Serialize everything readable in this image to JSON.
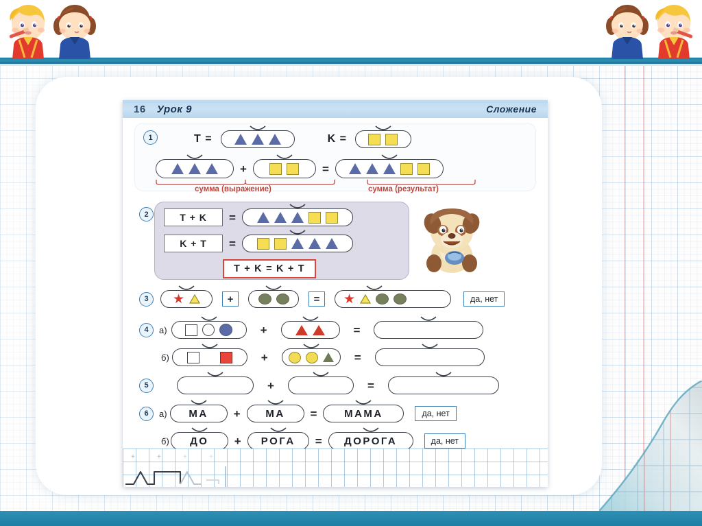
{
  "slide": {
    "background": "graph-paper",
    "card_color": "#ffffff",
    "accent_color": "#2e8fb4",
    "decorations": {
      "top_left_kids": [
        "boy-with-pencil-icon",
        "girl-with-pigtails-icon"
      ],
      "top_right_kids": [
        "girl-with-pigtails-icon",
        "boy-with-pencil-icon"
      ],
      "page_curl": "page-curl-icon"
    }
  },
  "book": {
    "header": {
      "page_number": "16",
      "lesson": "Урок 9",
      "topic": "Сложение"
    },
    "ex1": {
      "number": "1",
      "def_t_label": "T =",
      "def_t_shapes": [
        "triangle-blue",
        "triangle-blue",
        "triangle-blue"
      ],
      "def_k_label": "K =",
      "def_k_shapes": [
        "square-yellow",
        "square-yellow"
      ],
      "left_shapes": [
        "triangle-blue",
        "triangle-blue",
        "triangle-blue"
      ],
      "plus": "+",
      "right_shapes": [
        "square-yellow",
        "square-yellow"
      ],
      "equals": "=",
      "result_shapes": [
        "triangle-blue",
        "triangle-blue",
        "triangle-blue",
        "square-yellow",
        "square-yellow"
      ],
      "label_expression": "сумма  (выражение)",
      "label_result": "сумма  (результат)",
      "label_color": "#c0453a"
    },
    "ex2": {
      "number": "2",
      "row_a_label": "T + K",
      "row_a_equals": "=",
      "row_a_shapes": [
        "triangle-blue",
        "triangle-blue",
        "triangle-blue",
        "square-yellow",
        "square-yellow"
      ],
      "row_b_label": "K + T",
      "row_b_equals": "=",
      "row_b_shapes": [
        "square-yellow",
        "square-yellow",
        "triangle-blue",
        "triangle-blue",
        "triangle-blue"
      ],
      "conclusion": "T + K  =  K + T",
      "conclusion_border_color": "#d8453a",
      "mascot": "puppy-mascot-icon",
      "panel_color": "#dedbe8"
    },
    "ex3": {
      "number": "3",
      "left_shapes": [
        "star-red",
        "triangle-yellow"
      ],
      "plus": "+",
      "mid_shapes": [
        "circle-olive",
        "circle-olive"
      ],
      "equals": "=",
      "result_shapes": [
        "star-red",
        "triangle-yellow",
        "circle-olive",
        "circle-olive"
      ],
      "yesno": "да, нет"
    },
    "ex4": {
      "number": "4",
      "rows": [
        {
          "sublabel": "а)",
          "left_shapes": [
            "square-white",
            "circle-white",
            "circle-blue"
          ],
          "plus": "+",
          "mid_shapes": [
            "triangle-red",
            "triangle-red"
          ],
          "equals": "=",
          "result_shapes": []
        },
        {
          "sublabel": "б)",
          "left_shapes": [
            "square-white",
            "square-red"
          ],
          "plus": "+",
          "mid_shapes": [
            "circle-yellow",
            "circle-yellow",
            "triangle-olive"
          ],
          "equals": "=",
          "result_shapes": []
        }
      ]
    },
    "ex5": {
      "number": "5",
      "left": "",
      "plus": "+",
      "mid": "",
      "equals": "=",
      "result": ""
    },
    "ex6": {
      "number": "6",
      "rows": [
        {
          "sublabel": "а)",
          "left": "МА",
          "plus": "+",
          "mid": "МА",
          "equals": "=",
          "result": "МАМА",
          "yesno": "да, нет"
        },
        {
          "sublabel": "б)",
          "left": "ДО",
          "plus": "+",
          "mid": "РОГА",
          "equals": "=",
          "result": "ДОРОГА",
          "yesno": "да, нет"
        }
      ]
    },
    "grid_strip": {
      "plus_marks": [
        "+",
        "+",
        "+",
        "+"
      ],
      "pattern": "zigzag-square-triangle-line"
    }
  }
}
